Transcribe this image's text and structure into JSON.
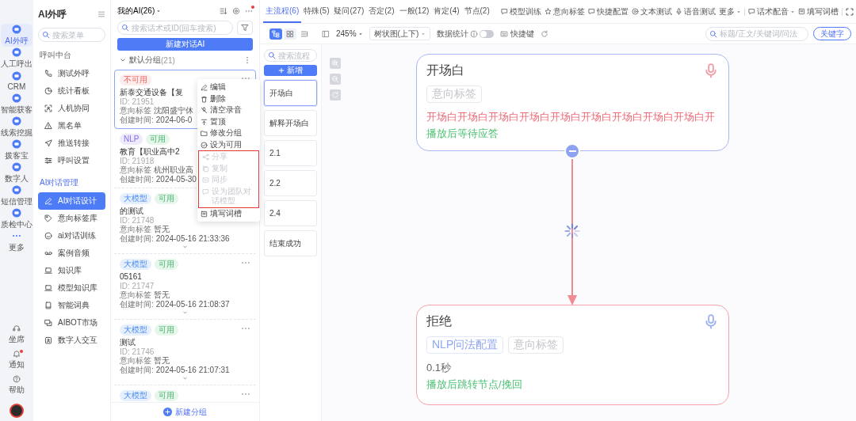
{
  "rail": {
    "items": [
      {
        "label": "AI外呼",
        "selected": true
      },
      {
        "label": "人工呼出",
        "selected": false
      },
      {
        "label": "CRM",
        "selected": false
      },
      {
        "label": "智能获客",
        "selected": false
      },
      {
        "label": "线索挖掘",
        "selected": false
      },
      {
        "label": "拨客宝",
        "selected": false
      },
      {
        "label": "数字人",
        "selected": false
      },
      {
        "label": "短信管理",
        "selected": false
      },
      {
        "label": "质检中心",
        "selected": false
      },
      {
        "label": "更多",
        "selected": false
      }
    ],
    "bottom": [
      {
        "label": "坐席",
        "dot": false
      },
      {
        "label": "通知",
        "dot": true
      },
      {
        "label": "帮助",
        "dot": false
      }
    ]
  },
  "nav": {
    "title": "AI外呼",
    "search_placeholder": "搜索菜单",
    "sections": [
      {
        "title": "呼叫中台",
        "active": false,
        "items": [
          {
            "label": "测试外呼",
            "selected": false
          },
          {
            "label": "统计看板",
            "selected": false
          },
          {
            "label": "人机协同",
            "selected": false
          },
          {
            "label": "黑名单",
            "selected": false
          },
          {
            "label": "推送转接",
            "selected": false
          },
          {
            "label": "呼叫设置",
            "selected": false
          }
        ]
      },
      {
        "title": "AI对话管理",
        "active": true,
        "items": [
          {
            "label": "AI对话设计",
            "selected": true
          },
          {
            "label": "意向标签库",
            "selected": false
          },
          {
            "label": "ai对话训练",
            "selected": false
          },
          {
            "label": "案例音频",
            "selected": false
          },
          {
            "label": "知识库",
            "selected": false
          },
          {
            "label": "模型知识库",
            "selected": false
          },
          {
            "label": "智能词典",
            "selected": false
          },
          {
            "label": "AIBOT市场",
            "selected": false
          },
          {
            "label": "数字人交互",
            "selected": false
          }
        ]
      }
    ]
  },
  "list": {
    "title": "我的AI(26)",
    "dot": true,
    "search_placeholder": "搜索话术或ID(回车搜索)",
    "new_button": "新建对话AI",
    "group": {
      "name": "默认分组",
      "count": "(21)",
      "expanded": true
    },
    "cards": [
      {
        "tags": [
          {
            "label": "不可用",
            "kind": "unavailable"
          }
        ],
        "title": "新泰交通设备【复",
        "id": "ID: 21951",
        "intent_label": "意向标签",
        "intent": "沈阳盛宁休",
        "created_label": "创建时间:",
        "created": "2024-06-0",
        "selected": true,
        "more_button": true,
        "expandable": false
      },
      {
        "tags": [
          {
            "label": "NLP",
            "kind": "nlp"
          },
          {
            "label": "可用",
            "kind": "available"
          }
        ],
        "title": "教育【职业高中2",
        "id": "ID: 21918",
        "intent_label": "意向标签",
        "intent": "杭州职业高",
        "created_label": "创建时间:",
        "created": "2024-05-30",
        "selected": false,
        "more_button": false,
        "expandable": false
      },
      {
        "tags": [
          {
            "label": "大模型",
            "kind": "llm"
          },
          {
            "label": "可用",
            "kind": "available"
          }
        ],
        "title": "的测试",
        "id": "ID: 21748",
        "intent_label": "意向标签",
        "intent": "暂无",
        "created_label": "创建时间:",
        "created": "2024-05-16 21:33:36",
        "selected": false,
        "more_button": false,
        "expandable": true
      },
      {
        "tags": [
          {
            "label": "大模型",
            "kind": "llm"
          },
          {
            "label": "可用",
            "kind": "available"
          }
        ],
        "title": "05161",
        "id": "ID: 21747",
        "intent_label": "意向标签",
        "intent": "暂无",
        "created_label": "创建时间:",
        "created": "2024-05-16 21:08:37",
        "selected": false,
        "more_button": true,
        "expandable": true
      },
      {
        "tags": [
          {
            "label": "大模型",
            "kind": "llm"
          },
          {
            "label": "可用",
            "kind": "available"
          }
        ],
        "title": "测试",
        "id": "ID: 21746",
        "intent_label": "意向标签",
        "intent": "暂无",
        "created_label": "创建时间:",
        "created": "2024-05-16 21:07:31",
        "selected": false,
        "more_button": true,
        "expandable": true
      },
      {
        "tags": [
          {
            "label": "大模型",
            "kind": "llm"
          },
          {
            "label": "可用",
            "kind": "available"
          }
        ],
        "selected": false,
        "more_button": true,
        "expandable": false
      }
    ],
    "add_group": "新建分组"
  },
  "context_menu": {
    "items": [
      {
        "label": "编辑",
        "disabled": false,
        "highlighted": false
      },
      {
        "label": "删除",
        "disabled": false,
        "highlighted": false
      },
      {
        "label": "清空录音",
        "disabled": false,
        "highlighted": false
      },
      {
        "label": "置顶",
        "disabled": false,
        "highlighted": false
      },
      {
        "label": "修改分组",
        "disabled": false,
        "highlighted": false
      },
      {
        "label": "设为可用",
        "disabled": false,
        "highlighted": false
      },
      {
        "label": "分享",
        "disabled": true,
        "highlighted": true
      },
      {
        "label": "复制",
        "disabled": true,
        "highlighted": true
      },
      {
        "label": "同步",
        "disabled": true,
        "highlighted": true
      },
      {
        "label": "设为团队对话模型",
        "disabled": true,
        "highlighted": true
      },
      {
        "label": "填写词槽",
        "disabled": false,
        "highlighted": false
      }
    ]
  },
  "tabs": [
    {
      "label": "主流程(6)",
      "selected": true
    },
    {
      "label": "特殊(5)",
      "selected": false
    },
    {
      "label": "疑问(27)",
      "selected": false
    },
    {
      "label": "否定(2)",
      "selected": false
    },
    {
      "label": "一般(12)",
      "selected": false
    },
    {
      "label": "肯定(4)",
      "selected": false
    },
    {
      "label": "节点(2)",
      "selected": false
    }
  ],
  "actions": [
    {
      "label": "模型训练",
      "dropdown": false
    },
    {
      "label": "意向标签",
      "dropdown": false
    },
    {
      "label": "快捷配置",
      "dropdown": false
    },
    {
      "label": "文本测试",
      "dropdown": false
    },
    {
      "label": "语音测试",
      "dropdown": false
    },
    {
      "label": "更多",
      "dropdown": true
    },
    {
      "label": "话术配音",
      "dropdown": true
    },
    {
      "label": "填写词槽",
      "dropdown": false
    }
  ],
  "toolbar": {
    "view_modes": [
      {
        "selected": true
      },
      {
        "selected": false
      },
      {
        "selected": false
      }
    ],
    "zoom": "245%",
    "layout": "树状图(上下)",
    "stats_label": "数据统计",
    "stats_on": false,
    "shortcut": "快捷键",
    "search_placeholder": "标题/正文/关键词/问法",
    "keyword_button": "关键字"
  },
  "flows": {
    "search_placeholder": "搜索流程",
    "add_button": "新增",
    "items": [
      {
        "label": "开场白",
        "selected": true
      },
      {
        "label": "解释开场白",
        "selected": false
      },
      {
        "label": "2.1",
        "selected": false
      },
      {
        "label": "2.2",
        "selected": false
      },
      {
        "label": "2.4",
        "selected": false
      },
      {
        "label": "结束成功",
        "selected": false
      }
    ]
  },
  "canvas": {
    "nodes": [
      {
        "title": "开场白",
        "color": "#a9b8f6",
        "tags": [
          {
            "label": "意向标签",
            "kind": "intent"
          }
        ],
        "text": "开场白开场白开场白开场白开场白开场白开场白开场白开场白开",
        "status": "播放后等待应答"
      },
      {
        "title": "拒绝",
        "color": "#f4a3ad",
        "tags": [
          {
            "label": "NLP问法配置",
            "kind": "nlp"
          },
          {
            "label": "意向标签",
            "kind": "intent"
          }
        ],
        "delay": "0.1秒",
        "status": "播放后跳转节点/挽回"
      }
    ]
  }
}
